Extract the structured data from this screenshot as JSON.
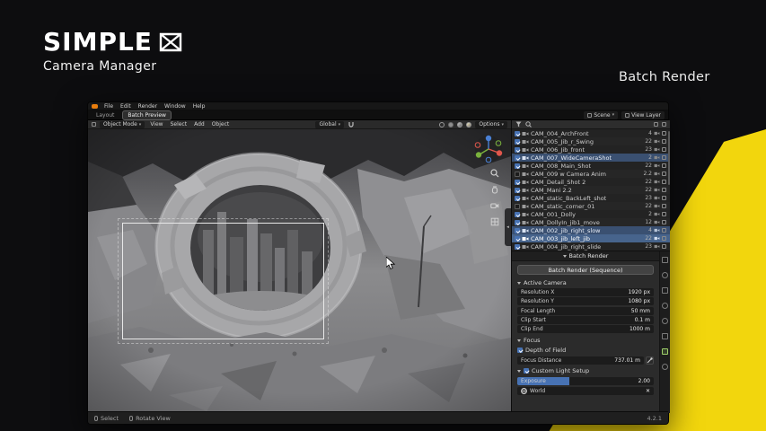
{
  "brand": {
    "title": "SIMPLE",
    "subtitle": "Camera Manager",
    "corner_label": "Batch Render"
  },
  "colors": {
    "accent_yellow": "#f2d60d",
    "blender_selection_blue": "#4772b3",
    "axis_red": "#e0564c",
    "axis_green": "#7ab23d",
    "axis_blue": "#4a80d4"
  },
  "topbar": {
    "menus": [
      "File",
      "Edit",
      "Render",
      "Window",
      "Help"
    ],
    "tabs": {
      "inactive": "Layout",
      "active": "Batch Preview"
    },
    "scene": "Scene",
    "view_layer": "View Layer"
  },
  "viewport_header": {
    "mode": "Object Mode",
    "menus": [
      "View",
      "Select",
      "Add",
      "Object"
    ],
    "orientation": "Global",
    "options": "Options"
  },
  "outliner": {
    "rows": [
      {
        "name": "CAM_004_ArchFront",
        "num": "4",
        "checked": true
      },
      {
        "name": "CAM_005_Jib_r_Swing",
        "num": "22",
        "checked": true
      },
      {
        "name": "CAM_006_Jib_front",
        "num": "23",
        "checked": true
      },
      {
        "name": "CAM_007_WideCameraShot",
        "num": "2",
        "checked": true,
        "selected": true
      },
      {
        "name": "CAM_008_Main_Shot",
        "num": "22",
        "checked": true
      },
      {
        "name": "CAM_009 w Camera Anim",
        "num": "2.2",
        "checked": false
      },
      {
        "name": "CAM_Detail_Shot 2",
        "num": "22",
        "checked": true
      },
      {
        "name": "CAM_Mani 2.2",
        "num": "22",
        "checked": true
      },
      {
        "name": "CAM_static_BackLeft_shot",
        "num": "23",
        "checked": true
      },
      {
        "name": "CAM_static_corner_01",
        "num": "22",
        "checked": false
      },
      {
        "name": "CAM_001_Dolly",
        "num": "2",
        "checked": true
      },
      {
        "name": "CAM_DollyIn_jib1_move",
        "num": "12",
        "checked": true
      },
      {
        "name": "CAM_002_jib_right_slow",
        "num": "4",
        "checked": true,
        "selected": true
      },
      {
        "name": "CAM_003_jib_left_jib",
        "num": "22",
        "checked": true,
        "selected": true,
        "active": true
      },
      {
        "name": "CAM_004_jib_right_slide",
        "num": "23",
        "checked": true
      }
    ]
  },
  "properties": {
    "panel_title": "Batch Render",
    "render_button": "Batch Render (Sequence)",
    "active_camera": "Active Camera",
    "fields": {
      "resolution_x_label": "Resolution X",
      "resolution_x_value": "1920 px",
      "resolution_y_label": "Resolution Y",
      "resolution_y_value": "1080 px",
      "focal_length_label": "Focal Length",
      "focal_length_value": "50 mm",
      "clip_start_label": "Clip Start",
      "clip_start_value": "0.1 m",
      "clip_end_label": "Clip End",
      "clip_end_value": "1000 m"
    },
    "focus_section": "Focus",
    "dof_label": "Depth of Field",
    "dof_checked": true,
    "focus_distance_label": "Focus Distance",
    "focus_distance_value": "737.01 m",
    "custom_light_label": "Custom Light Setup",
    "custom_light_checked": true,
    "exposure_label": "Exposure",
    "exposure_value": "2.00",
    "world_label": "World",
    "world_value": "World"
  },
  "statusbar": {
    "hints": [
      "Select",
      "Rotate View"
    ],
    "version": "4.2.1"
  }
}
